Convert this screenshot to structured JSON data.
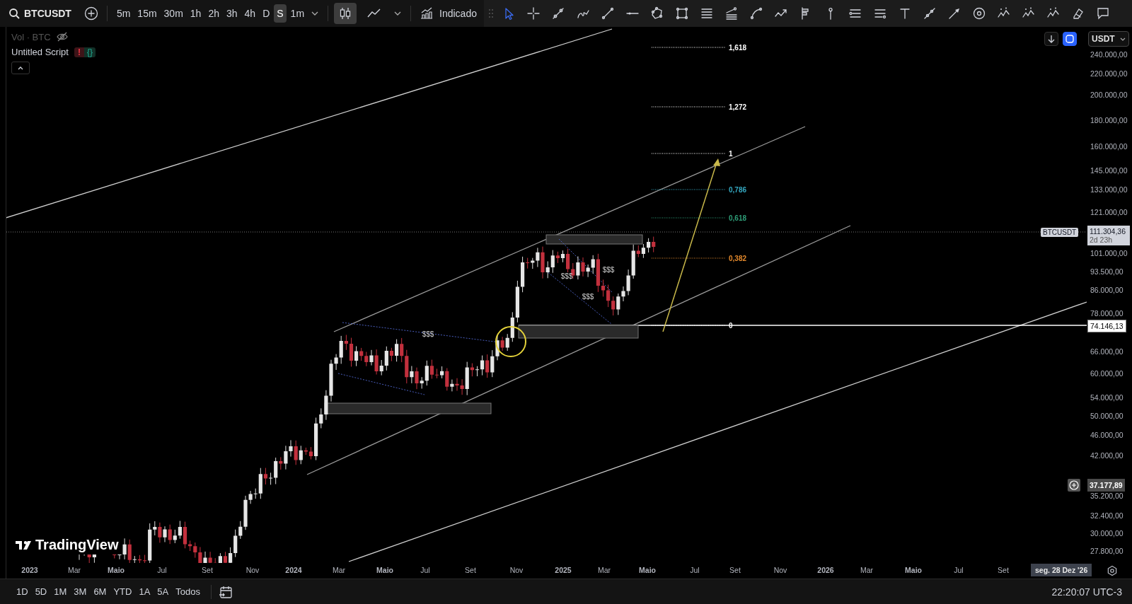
{
  "toolbar": {
    "symbol": "BTCUSDT",
    "timeframes": [
      {
        "label": "5m",
        "selected": false
      },
      {
        "label": "15m",
        "selected": false
      },
      {
        "label": "30m",
        "selected": false
      },
      {
        "label": "1h",
        "selected": false
      },
      {
        "label": "2h",
        "selected": false
      },
      {
        "label": "3h",
        "selected": false
      },
      {
        "label": "4h",
        "selected": false
      },
      {
        "label": "D",
        "selected": false
      },
      {
        "label": "S",
        "selected": true
      },
      {
        "label": "1m",
        "selected": false
      }
    ],
    "chart_types": [
      {
        "kind": "candles",
        "selected": true
      },
      {
        "kind": "line",
        "selected": false
      }
    ],
    "indicators_label": "Indicado"
  },
  "drawing_tools": [
    {
      "kind": "cursor",
      "selected": true
    },
    {
      "kind": "crosshair",
      "selected": false
    },
    {
      "kind": "trend-line",
      "selected": false
    },
    {
      "kind": "brush",
      "selected": false
    },
    {
      "kind": "line",
      "selected": false
    },
    {
      "kind": "horizontal-ray",
      "selected": false
    },
    {
      "kind": "pattern",
      "selected": false
    },
    {
      "kind": "rectangle",
      "selected": false
    },
    {
      "kind": "fib-retracement",
      "selected": false
    },
    {
      "kind": "fib-channel",
      "selected": false
    },
    {
      "kind": "arc",
      "selected": false
    },
    {
      "kind": "path",
      "selected": false
    },
    {
      "kind": "position",
      "selected": false
    },
    {
      "kind": "vertical-pin",
      "selected": false
    },
    {
      "kind": "price-range",
      "selected": false
    },
    {
      "kind": "date-range",
      "selected": false
    },
    {
      "kind": "text",
      "selected": false
    },
    {
      "kind": "info-line",
      "selected": false
    },
    {
      "kind": "arrow-marker",
      "selected": false
    },
    {
      "kind": "circle",
      "selected": false
    },
    {
      "kind": "elliott-impulse",
      "selected": false
    },
    {
      "kind": "elliott-correction",
      "selected": false
    },
    {
      "kind": "elliott-triangle",
      "selected": false
    },
    {
      "kind": "eraser",
      "selected": false
    },
    {
      "kind": "callout",
      "selected": false
    }
  ],
  "legend": {
    "volume": "Vol · BTC",
    "volume_hidden": true,
    "script": "Untitled Script",
    "script_error": "!",
    "script_code": "{}"
  },
  "chart": {
    "fib_levels": [
      {
        "label": "1,618",
        "color": "#ffffff"
      },
      {
        "label": "1,272",
        "color": "#ffffff"
      },
      {
        "label": "1",
        "color": "#ffffff"
      },
      {
        "label": "0,786",
        "color": "#35a9c2"
      },
      {
        "label": "0,618",
        "color": "#2e9e78"
      },
      {
        "label": "0,382",
        "color": "#e3892c"
      },
      {
        "label": "0",
        "color": "#ffffff"
      }
    ],
    "liquidity_labels": [
      "$$$",
      "$$$",
      "$$$",
      "$$$"
    ],
    "logo": "TradingView"
  },
  "price_axis": {
    "currency": "USDT",
    "labels": [
      "240.000,00",
      "220.000,00",
      "200.000,00",
      "180.000,00",
      "160.000,00",
      "145.000,00",
      "133.000,00",
      "121.000,00",
      "101.000,00",
      "93.500,00",
      "86.000,00",
      "78.000,00",
      "66.000,00",
      "60.000,00",
      "54.000,00",
      "50.000,00",
      "46.000,00",
      "42.000,00",
      "35.200,00",
      "32.400,00",
      "30.000,00",
      "27.800,00"
    ],
    "symbol_tag": "BTCUSDT",
    "last_price": "111.304,36",
    "countdown": "2d 23h",
    "line_price": "74.146,13",
    "cursor_price": "37.177,89"
  },
  "time_axis": {
    "labels": [
      "2023",
      "Mar",
      "Maio",
      "Jul",
      "Set",
      "Nov",
      "2024",
      "Mar",
      "Maio",
      "Jul",
      "Set",
      "Nov",
      "2025",
      "Mar",
      "Maio",
      "Jul",
      "Set",
      "Nov",
      "2026",
      "Mar",
      "Maio",
      "Jul",
      "Set"
    ],
    "cursor_date": "seg. 28 Dez '26"
  },
  "bottom_bar": {
    "ranges": [
      "1D",
      "5D",
      "1M",
      "3M",
      "6M",
      "YTD",
      "1A",
      "5A",
      "Todos"
    ],
    "clock": "22:20:07 UTC-3"
  }
}
